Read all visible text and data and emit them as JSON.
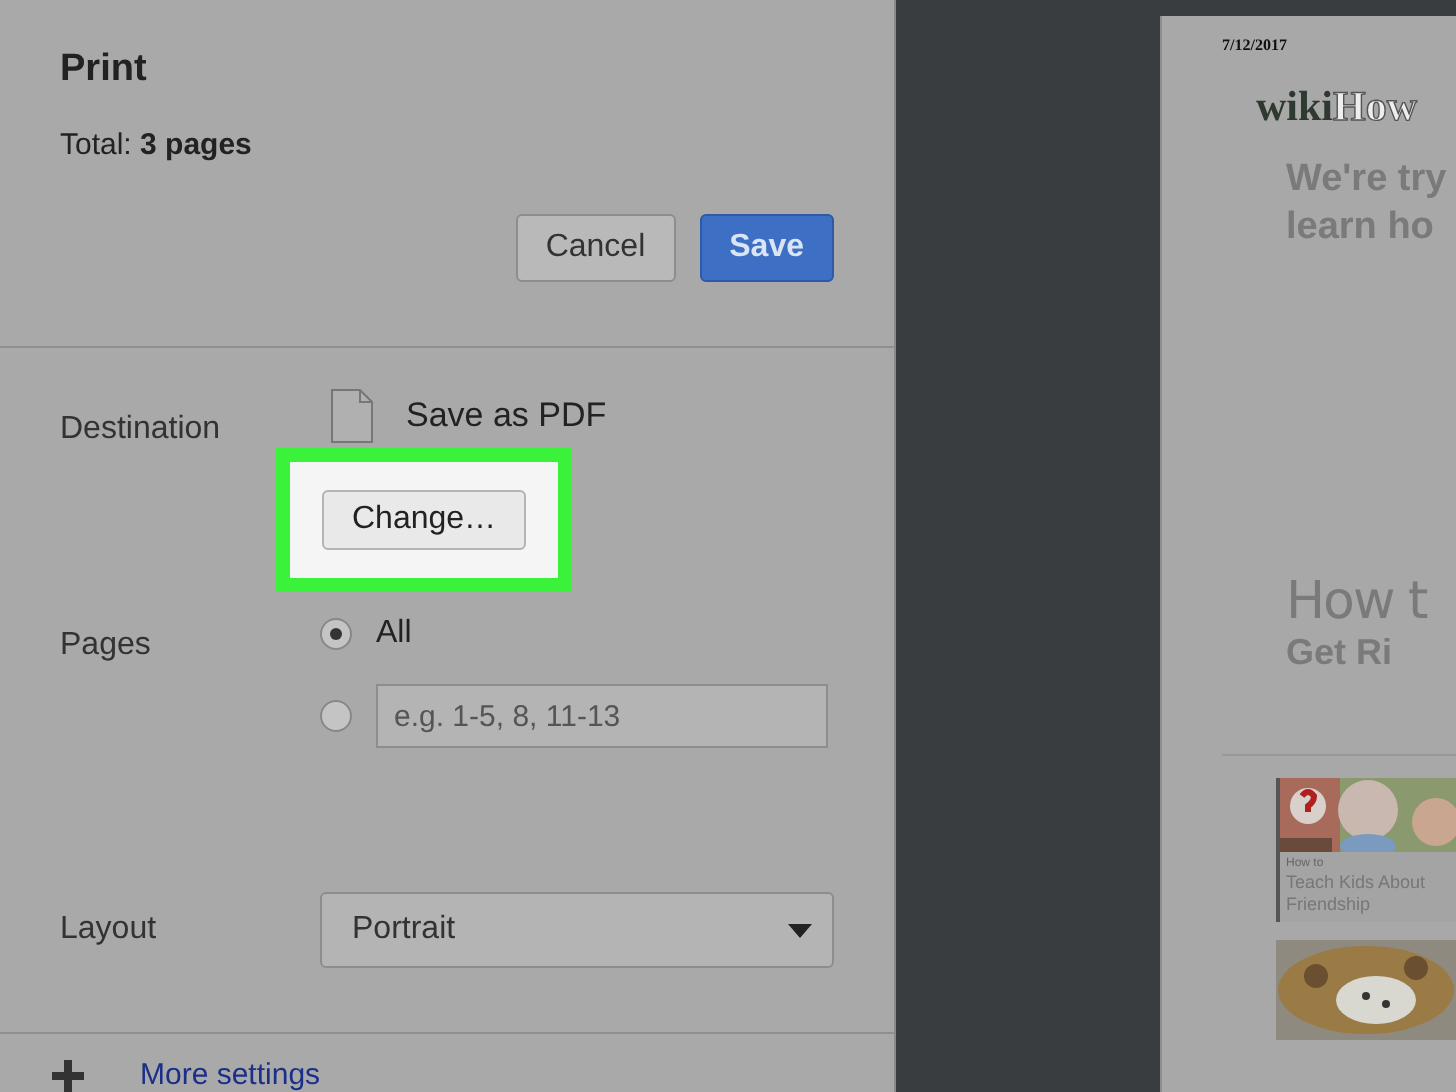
{
  "dialog": {
    "title": "Print",
    "total": "Total: **3 pages**",
    "buttons": [
      {
        "label": "Cancel",
        "kind": "secondary"
      },
      {
        "label": "Save",
        "kind": "primary"
      }
    ],
    "settings": [
      {
        "kind": "destination",
        "label": "Destination",
        "value": "Save as PDF",
        "button": "Change…",
        "highlighted": true
      },
      {
        "kind": "pages",
        "label": "Pages",
        "options": [
          {
            "kind": "text",
            "label": "All",
            "selected": true
          },
          {
            "kind": "field",
            "placeholder": "e.g. 1-5, 8, 11-13",
            "selected": false
          }
        ]
      },
      {
        "kind": "select",
        "label": "Layout",
        "value": "Portrait"
      }
    ],
    "more_settings": "More settings"
  },
  "preview": {
    "date": "7/12/2017",
    "logo": [
      "wiki",
      "How"
    ],
    "headline": [
      "We're try",
      "learn ho"
    ],
    "script_title": "How t",
    "subtitle": "Get Ri",
    "cards": [
      {
        "kind": "article",
        "kicker": "How to",
        "title": "Teach Kids About Friendship"
      },
      {
        "kind": "picture"
      }
    ]
  }
}
